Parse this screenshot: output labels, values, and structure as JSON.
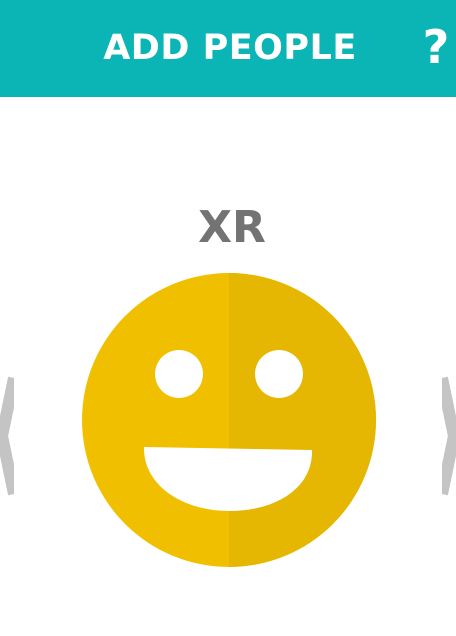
{
  "header": {
    "title": "ADD PEOPLE",
    "help_label": "?"
  },
  "profile": {
    "initials": "XR",
    "avatar_icon": "smiley-face-icon",
    "avatar_color": "#f0c000",
    "avatar_shade_color": "#e5b703"
  },
  "navigation": {
    "prev_icon": "chevron-left-icon",
    "next_icon": "chevron-right-icon",
    "arrow_color": "#c4c4c4"
  },
  "colors": {
    "header_background": "#0cb5b5",
    "text_gray": "#737373"
  }
}
